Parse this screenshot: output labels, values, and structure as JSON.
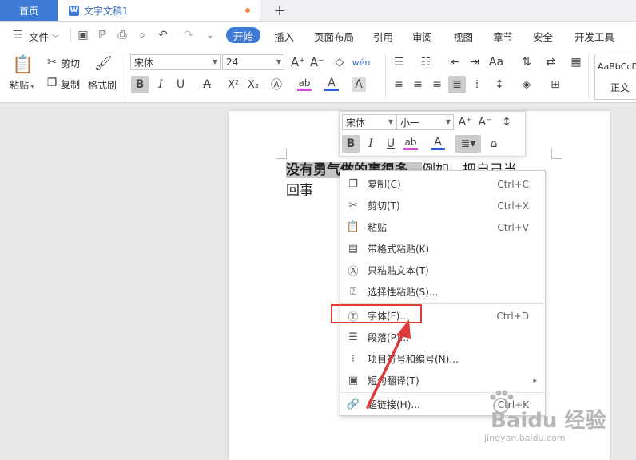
{
  "tabs": {
    "home": "首页",
    "doc_title": "文字文稿1",
    "doc_icon": "W",
    "new_tab": "+"
  },
  "menu": {
    "file": "文件",
    "items": [
      "开始",
      "插入",
      "页面布局",
      "引用",
      "审阅",
      "视图",
      "章节",
      "安全",
      "开发工具"
    ]
  },
  "ribbon": {
    "paste": "粘贴",
    "cut": "剪切",
    "copy": "复制",
    "format_painter": "格式刷",
    "font_name": "宋体",
    "font_size": "24",
    "style_preview": "AaBbCcD",
    "style_name": "正文",
    "bold": "B",
    "italic": "I",
    "underline": "U"
  },
  "document": {
    "selected_text": "没有勇气做的事很多，",
    "line1_rest": "例如，把自己当",
    "line2": "回事"
  },
  "mini_toolbar": {
    "font_name": "宋体",
    "font_size": "小一"
  },
  "context_menu": {
    "items": [
      {
        "label": "复制(C)",
        "shortcut": "Ctrl+C",
        "icon": "copy-icon"
      },
      {
        "label": "剪切(T)",
        "shortcut": "Ctrl+X",
        "icon": "scissors-icon"
      },
      {
        "label": "粘贴",
        "shortcut": "Ctrl+V",
        "icon": "paste-icon"
      },
      {
        "label": "带格式粘贴(K)",
        "shortcut": "",
        "icon": "paste-format-icon"
      },
      {
        "label": "只粘贴文本(T)",
        "shortcut": "",
        "icon": "paste-text-icon"
      },
      {
        "label": "选择性粘贴(S)...",
        "shortcut": "",
        "icon": "paste-special-icon"
      },
      {
        "label": "字体(F)...",
        "shortcut": "Ctrl+D",
        "icon": "font-icon"
      },
      {
        "label": "段落(P)...",
        "shortcut": "",
        "icon": "paragraph-icon"
      },
      {
        "label": "项目符号和编号(N)...",
        "shortcut": "",
        "icon": "bullets-icon"
      },
      {
        "label": "短句翻译(T)",
        "shortcut": "",
        "icon": "translate-icon"
      },
      {
        "label": "超链接(H)...",
        "shortcut": "Ctrl+K",
        "icon": "link-icon"
      }
    ]
  },
  "watermark": {
    "brand": "Baidu 经验",
    "url": "jingyan.baidu.com"
  },
  "colors": {
    "accent": "#3e7bd6",
    "highlight_box": "#e03b3b"
  }
}
